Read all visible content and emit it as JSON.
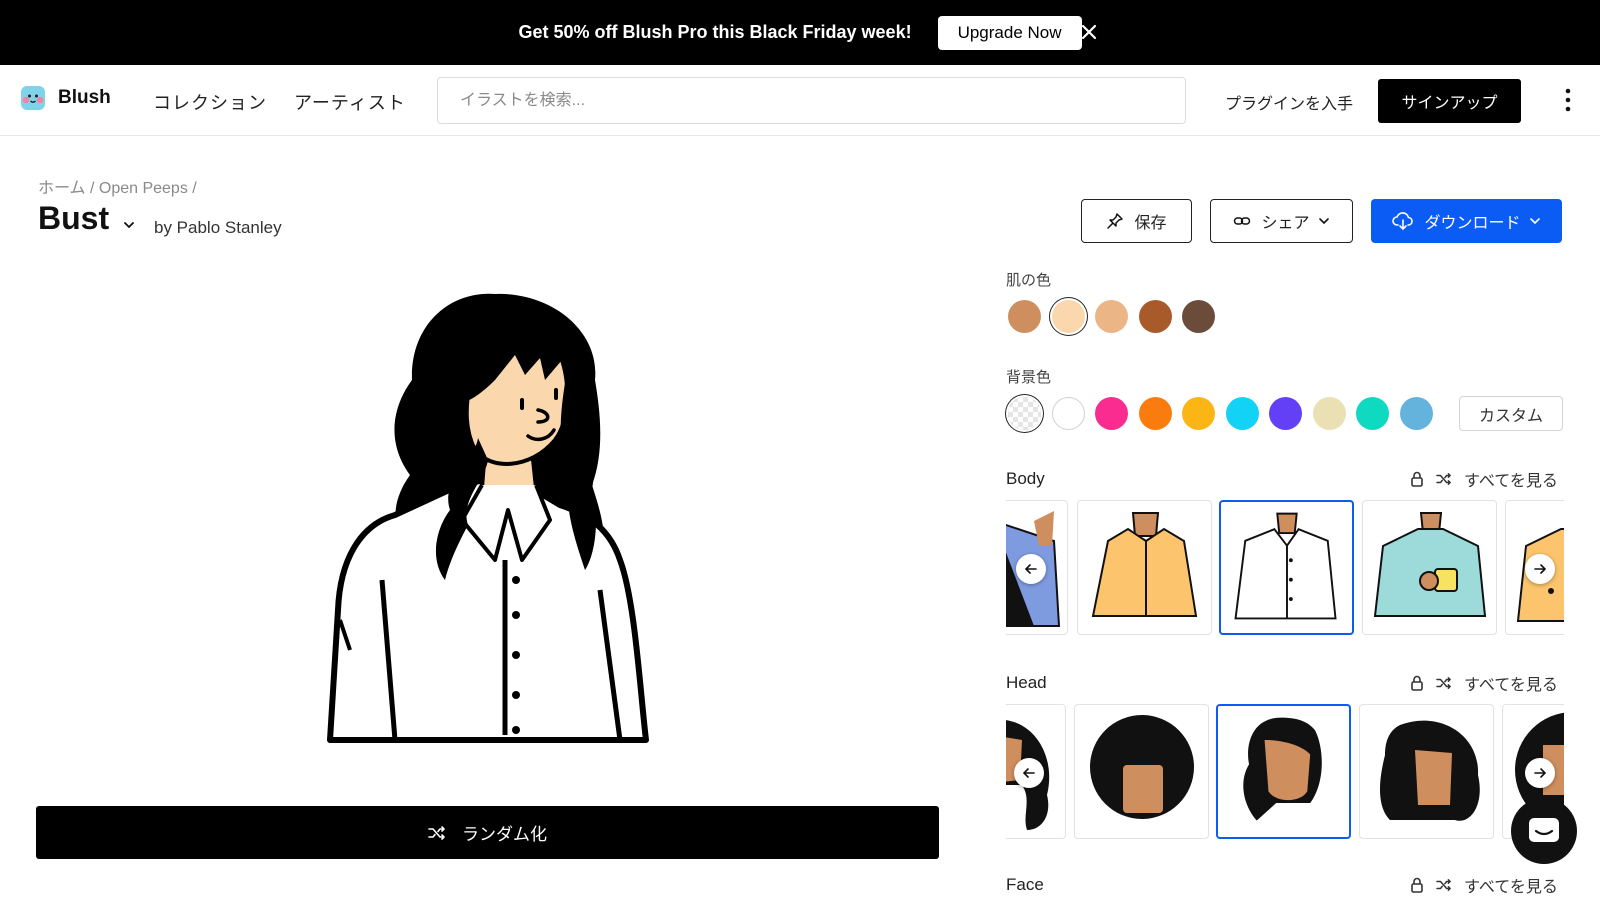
{
  "promo": {
    "text": "Get 50% off Blush Pro this Black Friday week!",
    "button": "Upgrade Now"
  },
  "nav": {
    "logo": "Blush",
    "links": [
      "コレクション",
      "アーティスト"
    ],
    "search_placeholder": "イラストを検索...",
    "plugin": "プラグインを入手",
    "signup": "サインアップ"
  },
  "breadcrumb": [
    "ホーム",
    "Open Peeps"
  ],
  "header": {
    "title": "Bust",
    "author": "by Pablo Stanley",
    "save": "保存",
    "share": "シェア",
    "download": "ダウンロード"
  },
  "randomize": "ランダム化",
  "skin": {
    "label": "肌の色",
    "colors": [
      "#cf8e5e",
      "#fbd7ae",
      "#ebb586",
      "#a85a2a",
      "#6b4c3b"
    ],
    "selected": 1
  },
  "background": {
    "label": "背景色",
    "colors": [
      "transparent",
      "#ffffff",
      "#fb2c8f",
      "#fb7c0e",
      "#fbb615",
      "#12d2f5",
      "#6340f5",
      "#ebdfb4",
      "#0fd9c0",
      "#63b3dc"
    ],
    "selected": 0,
    "custom": "カスタム"
  },
  "categories": [
    {
      "name": "Body",
      "see_all": "すべてを見る"
    },
    {
      "name": "Head",
      "see_all": "すべてを見る"
    },
    {
      "name": "Face",
      "see_all": "すべてを見る"
    }
  ],
  "colors": {
    "accent": "#0b5cf5",
    "dark": "#000000"
  }
}
